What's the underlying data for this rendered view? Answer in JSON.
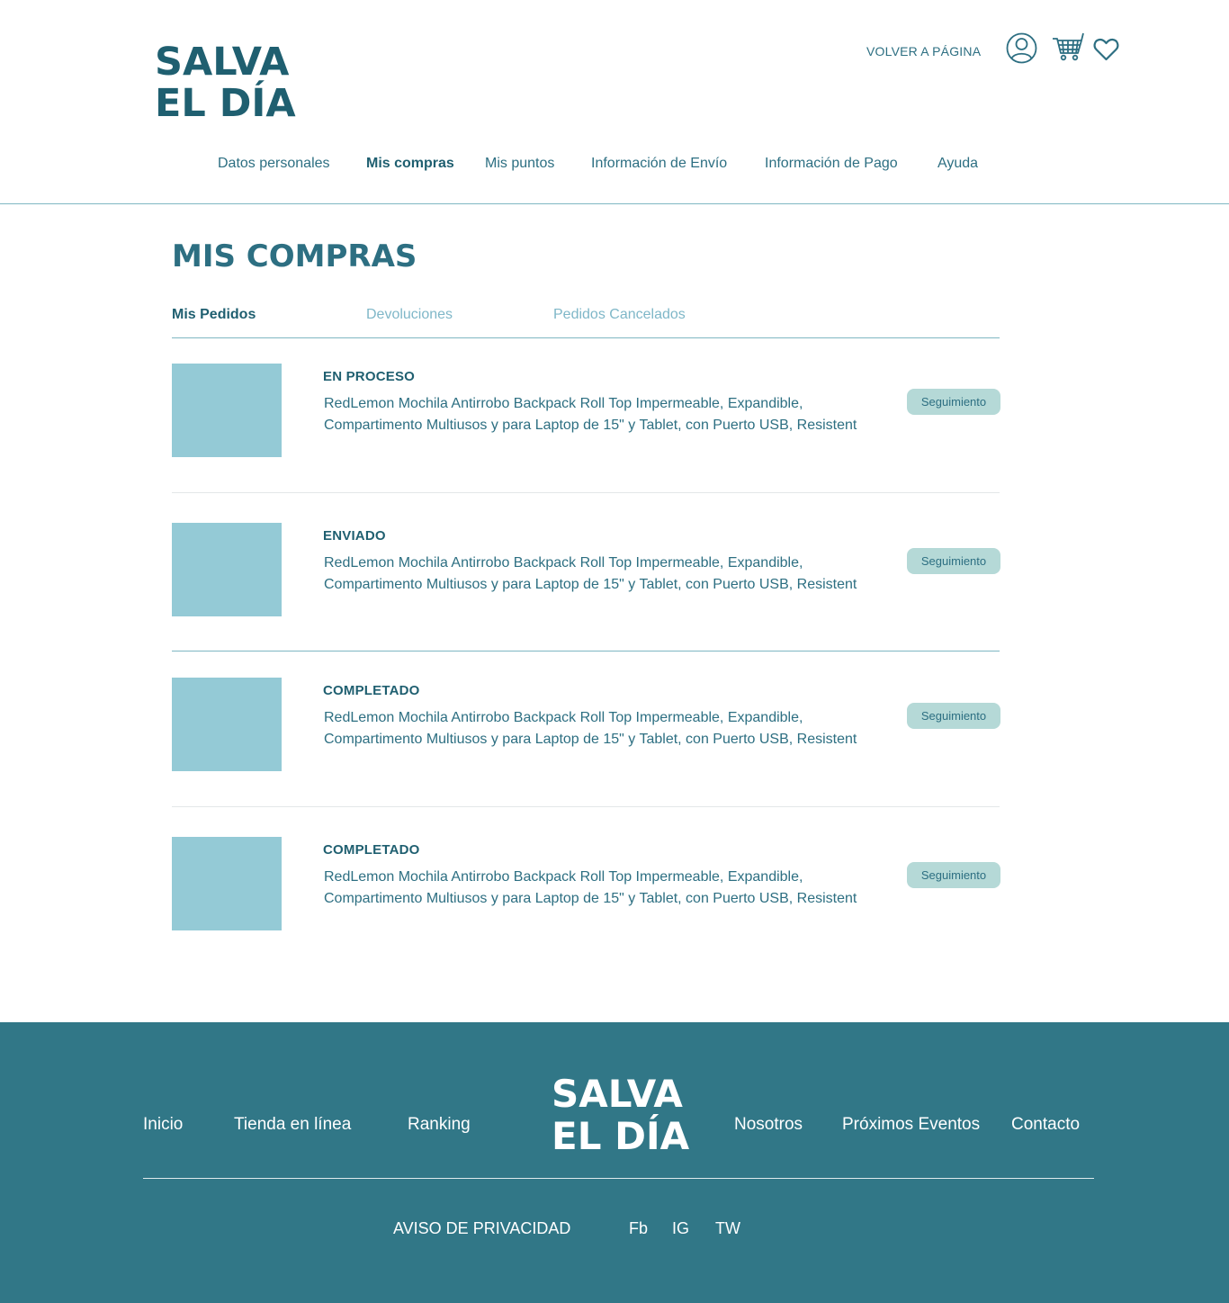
{
  "brand": {
    "line1": "SALVA",
    "line2": "EL DÍA"
  },
  "header": {
    "back_link": "VOLVER A PÁGINA",
    "icons": [
      "user-icon",
      "cart-icon",
      "heart-icon"
    ]
  },
  "nav": {
    "items": [
      {
        "label": "Datos personales",
        "active": false
      },
      {
        "label": "Mis compras",
        "active": true
      },
      {
        "label": "Mis puntos",
        "active": false
      },
      {
        "label": "Información de Envío",
        "active": false
      },
      {
        "label": "Información de Pago",
        "active": false
      },
      {
        "label": "Ayuda",
        "active": false
      }
    ]
  },
  "main": {
    "title": "MIS COMPRAS",
    "tabs": [
      {
        "label": "Mis Pedidos",
        "active": true
      },
      {
        "label": "Devoluciones",
        "active": false
      },
      {
        "label": "Pedidos Cancelados",
        "active": false
      }
    ],
    "orders": [
      {
        "status": "EN PROCESO",
        "line1": "RedLemon Mochila Antirrobo Backpack Roll Top Impermeable, Expandible,",
        "line2": "Compartimento Multiusos y para Laptop de 15\" y Tablet, con Puerto USB, Resistent",
        "button": "Seguimiento"
      },
      {
        "status": "ENVIADO",
        "line1": "RedLemon Mochila Antirrobo Backpack Roll Top Impermeable, Expandible,",
        "line2": "Compartimento Multiusos y para Laptop de 15\" y Tablet, con Puerto USB, Resistent",
        "button": "Seguimiento"
      },
      {
        "status": "COMPLETADO",
        "line1": "RedLemon Mochila Antirrobo Backpack Roll Top Impermeable, Expandible,",
        "line2": "Compartimento Multiusos y para Laptop de 15\" y Tablet, con Puerto USB, Resistent",
        "button": "Seguimiento"
      },
      {
        "status": "COMPLETADO",
        "line1": "RedLemon Mochila Antirrobo Backpack Roll Top Impermeable, Expandible,",
        "line2": "Compartimento Multiusos y para Laptop de 15\" y Tablet, con Puerto USB, Resistent",
        "button": "Seguimiento"
      }
    ]
  },
  "footer": {
    "links": [
      "Inicio",
      "Tienda en línea",
      "Ranking",
      "Nosotros",
      "Próximos Eventos",
      "Contacto"
    ],
    "logo": {
      "line1": "SALVA",
      "line2": "EL DÍA"
    },
    "privacy": "AVISO DE PRIVACIDAD",
    "social": [
      "Fb",
      "IG",
      "TW"
    ]
  },
  "colors": {
    "primary": "#2d6f82",
    "footer_bg": "#317787",
    "thumb": "#94cad6",
    "button_bg": "#b5d9d7",
    "tab_inactive": "#7fb7c8"
  }
}
